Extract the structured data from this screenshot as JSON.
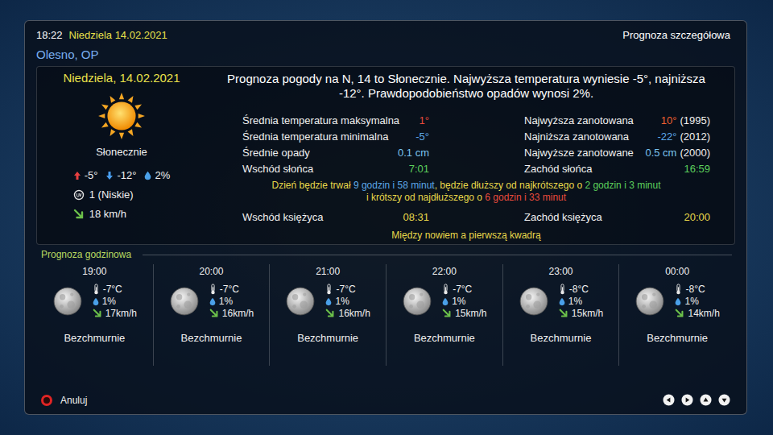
{
  "header": {
    "time": "18:22",
    "date": "Niedziela 14.02.2021",
    "title": "Prognoza szczegółowa",
    "location": "Olesno, OP"
  },
  "today": {
    "date": "Niedziela, 14.02.2021",
    "condition": "Słonecznie",
    "high": "-5°",
    "low": "-12°",
    "precip": "2%",
    "uv": "1 (Niskie)",
    "wind": "18 km/h"
  },
  "summary": "Prognoza pogody na N, 14 to Słonecznie. Najwyższa temperatura wyniesie -5°, najniższa -12°. Prawdopodobieństwo opadów wynosi 2%.",
  "statsLeft": [
    {
      "label": "Średnia temperatura maksymalna",
      "value": "1°",
      "color": "#e84a3c"
    },
    {
      "label": "Średnia temperatura minimalna",
      "value": "-5°",
      "color": "#5ca8e8"
    },
    {
      "label": "Średnie opady",
      "value": "0.1 cm",
      "color": "#7ac4f0"
    },
    {
      "label": "Wschód słońca",
      "value": "7:01",
      "color": "#5cd05c"
    }
  ],
  "statsRight": [
    {
      "label": "Najwyższa zanotowana",
      "value": "10°",
      "color": "#f06030",
      "note": "(1995)"
    },
    {
      "label": "Najniższa zanotowana",
      "value": "-22°",
      "color": "#5ca8e8",
      "note": "(2012)"
    },
    {
      "label": "Najwyższe zanotowane",
      "value": "0.5 cm",
      "color": "#7ac4f0",
      "note": "(2000)"
    },
    {
      "label": "Zachód słońca",
      "value": "16:59",
      "color": "#5cd05c"
    }
  ],
  "dayLength": [
    [
      {
        "text": "Dzień będzie trwał ",
        "color": "#e8d84a"
      },
      {
        "text": "9 godzin i 58 minut",
        "color": "#5ca8e8"
      },
      {
        "text": ", będzie dłuższy od najkrótszego o ",
        "color": "#e8d84a"
      },
      {
        "text": "2 godzin i 3 minut",
        "color": "#5cd05c"
      }
    ],
    [
      {
        "text": "i krótszy od najdłuższego o ",
        "color": "#e8d84a"
      },
      {
        "text": "6 godzin i 33 minut",
        "color": "#e84a3c"
      }
    ]
  ],
  "moon": {
    "riseLabel": "Wschód księżyca",
    "rise": "08:31",
    "setLabel": "Zachód księżyca",
    "set": "20:00",
    "phase": "Między nowiem a pierwszą kwadrą"
  },
  "hourlyTitle": "Prognoza godzinowa",
  "hourly": [
    {
      "time": "19:00",
      "temp": "-7°C",
      "precip": "1%",
      "wind": "17km/h",
      "condition": "Bezchmurnie"
    },
    {
      "time": "20:00",
      "temp": "-7°C",
      "precip": "1%",
      "wind": "16km/h",
      "condition": "Bezchmurnie"
    },
    {
      "time": "21:00",
      "temp": "-7°C",
      "precip": "1%",
      "wind": "16km/h",
      "condition": "Bezchmurnie"
    },
    {
      "time": "22:00",
      "temp": "-7°C",
      "precip": "1%",
      "wind": "15km/h",
      "condition": "Bezchmurnie"
    },
    {
      "time": "23:00",
      "temp": "-8°C",
      "precip": "1%",
      "wind": "15km/h",
      "condition": "Bezchmurnie"
    },
    {
      "time": "00:00",
      "temp": "-8°C",
      "precip": "1%",
      "wind": "14km/h",
      "condition": "Bezchmurnie"
    }
  ],
  "footer": {
    "cancel": "Anuluj"
  }
}
